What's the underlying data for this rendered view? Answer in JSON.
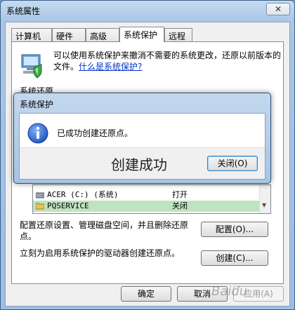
{
  "window": {
    "title": "系统属性",
    "close": "✕"
  },
  "tabs": [
    {
      "label": "计算机名"
    },
    {
      "label": "硬件"
    },
    {
      "label": "高级"
    },
    {
      "label": "系统保护"
    },
    {
      "label": "远程"
    }
  ],
  "panel": {
    "description": "可以使用系统保护来撤消不需要的系统更改，还原以前版本的文件。",
    "link": "什么是系统保护?",
    "section_label": "系统还原",
    "drives": [
      {
        "name": "ACER (C:) (系统)",
        "status": "打开"
      },
      {
        "name": "PQSERVICE",
        "status": "关闭"
      }
    ],
    "configure_text": "配置还原设置、管理磁盘空间，并且删除还原点。",
    "configure_button": "配置(O)...",
    "create_text": "立刻为启用系统保护的驱动器创建还原点。",
    "create_button": "创建(C)..."
  },
  "footer": {
    "ok": "确定",
    "cancel": "取消",
    "apply": "应用(A)"
  },
  "dialog": {
    "title": "系统保护",
    "message": "已成功创建还原点。",
    "close_button": "关闭(O)"
  },
  "overlay_caption": "创建成功",
  "watermark": "Baidu"
}
